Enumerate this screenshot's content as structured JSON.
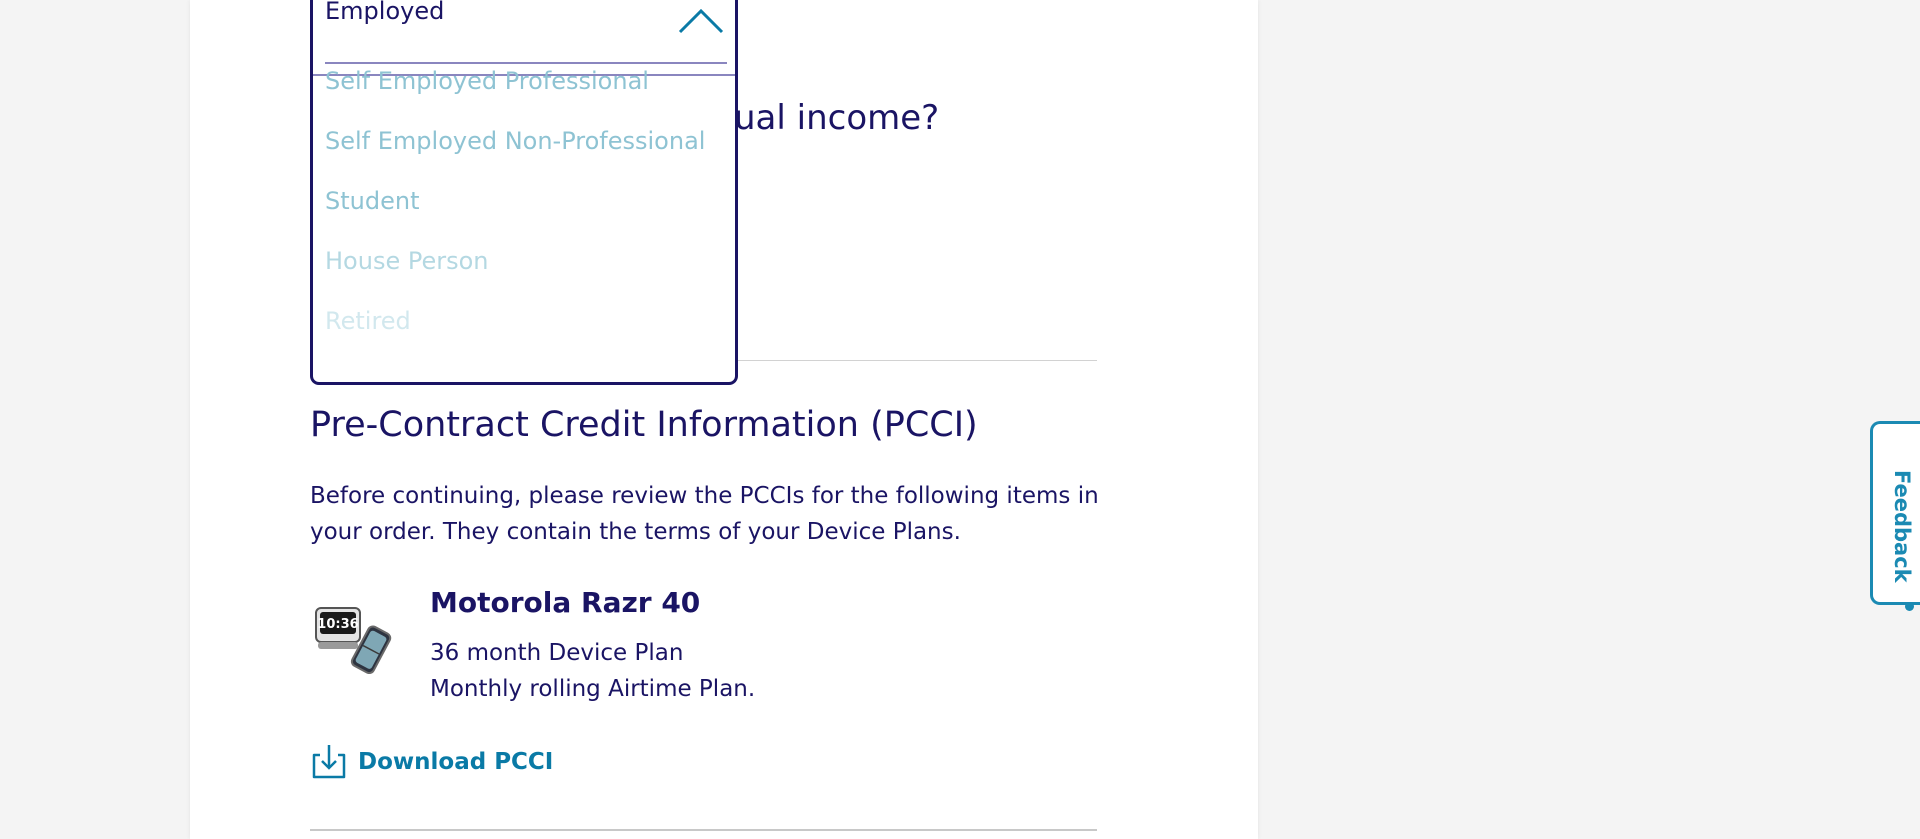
{
  "question": {
    "visible_text": "ual income?"
  },
  "employment_dropdown": {
    "selected_value": "Employed",
    "options": [
      "Self Employed Professional",
      "Self Employed Non-Professional",
      "Student",
      "House Person",
      "Retired"
    ]
  },
  "pcci": {
    "title": "Pre-Contract Credit Information (PCCI)",
    "description": "Before continuing, please review the PCCIs for the following items in your order. They contain the terms of your Device Plans.",
    "product": {
      "name": "Motorola Razr 40",
      "plan_lines": [
        "36 month Device Plan",
        "Monthly rolling Airtime Plan."
      ],
      "image_text": "10:36"
    },
    "download_label": "Download PCCI"
  },
  "feedback": {
    "label": "Feedback"
  },
  "colors": {
    "navy": "#1a1464",
    "link_blue": "#0a7aa6",
    "feedback_blue": "#1b8ab3",
    "option_faded": "#8ec3d3"
  },
  "icons": {
    "dropdown_toggle": "chevron-up-icon",
    "download": "download-icon"
  }
}
